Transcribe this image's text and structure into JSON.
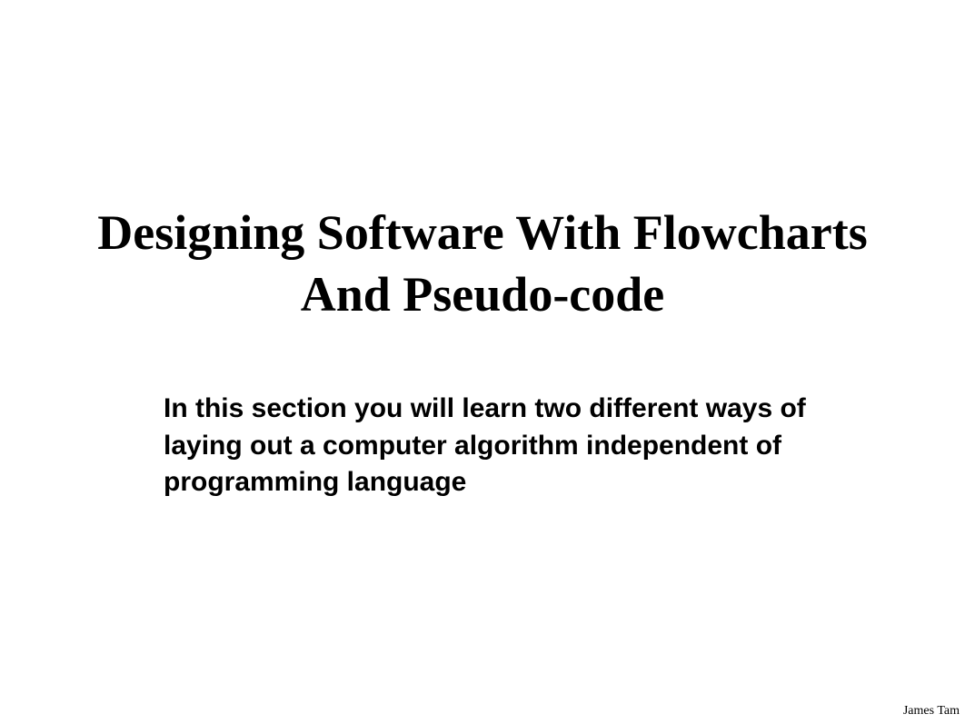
{
  "slide": {
    "title": "Designing Software With Flowcharts And Pseudo-code",
    "body": "In this section you will learn two different ways of laying out a computer algorithm independent of programming language",
    "footer": "James Tam"
  }
}
